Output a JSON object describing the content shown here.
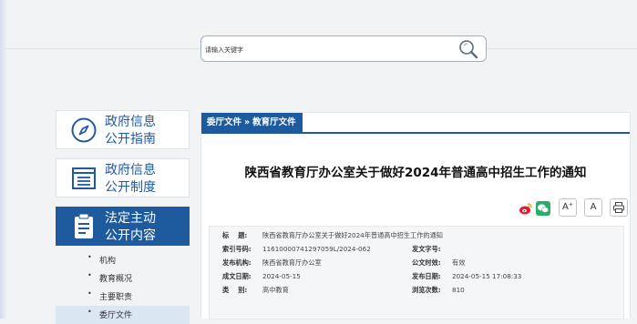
{
  "search": {
    "placeholder": "请输入关键字"
  },
  "sidebar": {
    "cards": [
      {
        "line1": "政府信息",
        "line2": "公开指南"
      },
      {
        "line1": "政府信息",
        "line2": "公开制度"
      },
      {
        "line1": "法定主动",
        "line2": "公开内容"
      }
    ],
    "subnav": [
      "机构",
      "教育概况",
      "主要职责",
      "委厅文件"
    ]
  },
  "breadcrumb": {
    "part1": "委厅文件",
    "sep": "»",
    "part2": "教育厅文件"
  },
  "article": {
    "title": "陕西省教育厅办公室关于做好2024年普通高中招生工作的通知",
    "font_large": "A⁺",
    "font_small": "A",
    "meta": {
      "title_key": "标    题:",
      "title_val": "陕西省教育厅办公室关于做好2024年普通高中招生工作的通知",
      "index_key": "索引号码:",
      "index_val": "11610000741297059L/2024-062",
      "docno_key": "发文字号:",
      "docno_val": "",
      "org_key": "发布机构:",
      "org_val": "陕西省教育厅办公室",
      "validity_key": "公文时效:",
      "validity_val": "有效",
      "created_key": "成文日期:",
      "created_val": "2024-05-15",
      "published_key": "发布日期:",
      "published_val": "2024-05-15 17:08:33",
      "category_key": "类    别:",
      "category_val": "高中教育",
      "views_key": "浏览次数:",
      "views_val": "810"
    }
  },
  "colors": {
    "primary": "#1d5a9e",
    "weibo": "#e6162d",
    "wechat": "#2aae67"
  }
}
